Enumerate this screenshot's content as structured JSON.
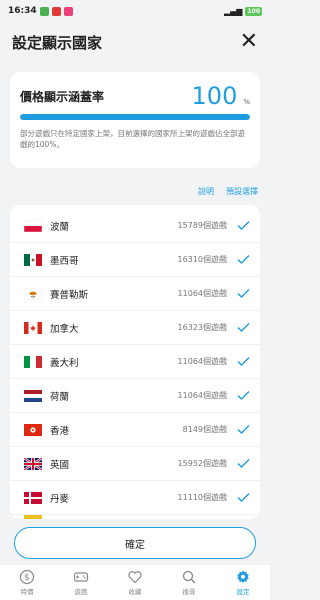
{
  "status_bar": {
    "time": "16:34",
    "battery": "100"
  },
  "header": {
    "title": "設定顯示國家",
    "close_glyph": "✕"
  },
  "coverage": {
    "label": "價格顯示涵蓋率",
    "value": "100",
    "unit": "%",
    "progress_percent": 100,
    "description": "部分遊戲只在特定國家上架，目前選擇的國家所上架的遊戲佔全部遊戲的100%。"
  },
  "links": {
    "help": "說明",
    "preset": "預設選擇"
  },
  "countries": [
    {
      "name": "波蘭",
      "count": "15789個遊戲",
      "flag": "poland-flag-icon",
      "checked": true
    },
    {
      "name": "墨西哥",
      "count": "16310個遊戲",
      "flag": "mexico-flag-icon",
      "checked": true
    },
    {
      "name": "賽普勒斯",
      "count": "11064個遊戲",
      "flag": "cyprus-flag-icon",
      "checked": true
    },
    {
      "name": "加拿大",
      "count": "16323個遊戲",
      "flag": "canada-flag-icon",
      "checked": true
    },
    {
      "name": "義大利",
      "count": "11064個遊戲",
      "flag": "italy-flag-icon",
      "checked": true
    },
    {
      "name": "荷蘭",
      "count": "11064個遊戲",
      "flag": "netherlands-flag-icon",
      "checked": true
    },
    {
      "name": "香港",
      "count": "8149個遊戲",
      "flag": "hongkong-flag-icon",
      "checked": true
    },
    {
      "name": "英國",
      "count": "15952個遊戲",
      "flag": "uk-flag-icon",
      "checked": true
    },
    {
      "name": "丹麥",
      "count": "11110個遊戲",
      "flag": "denmark-flag-icon",
      "checked": true
    }
  ],
  "confirm_label": "確定",
  "nav": [
    {
      "label": "特價",
      "icon": "dollar-icon",
      "active": false
    },
    {
      "label": "遊戲",
      "icon": "gamepad-icon",
      "active": false
    },
    {
      "label": "收藏",
      "icon": "heart-icon",
      "active": false
    },
    {
      "label": "搜尋",
      "icon": "search-icon",
      "active": false
    },
    {
      "label": "設定",
      "icon": "gear-icon",
      "active": true
    }
  ],
  "colors": {
    "accent": "#1e9ee0",
    "background": "#f2f3f5",
    "card": "#ffffff"
  }
}
